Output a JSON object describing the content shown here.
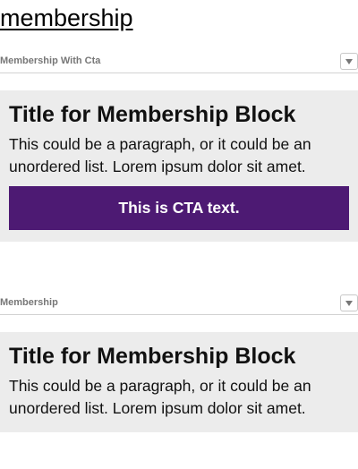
{
  "page": {
    "title": "membership"
  },
  "sections": [
    {
      "label": "Membership With Cta",
      "toggle_icon": "triangle-down-icon",
      "block": {
        "title": "Title for Membership Block",
        "body": "This could be a paragraph, or it could be an unordered list. Lorem ipsum dolor sit amet.",
        "cta_label": "This is CTA text."
      }
    },
    {
      "label": "Membership",
      "toggle_icon": "triangle-down-icon",
      "block": {
        "title": "Title for Membership Block",
        "body": "This could be a paragraph, or it could be an unordered list. Lorem ipsum dolor sit amet."
      }
    }
  ],
  "colors": {
    "block_background": "#ececec",
    "cta_background": "#4d1a73",
    "cta_text": "#ffffff",
    "section_label": "#777777"
  }
}
